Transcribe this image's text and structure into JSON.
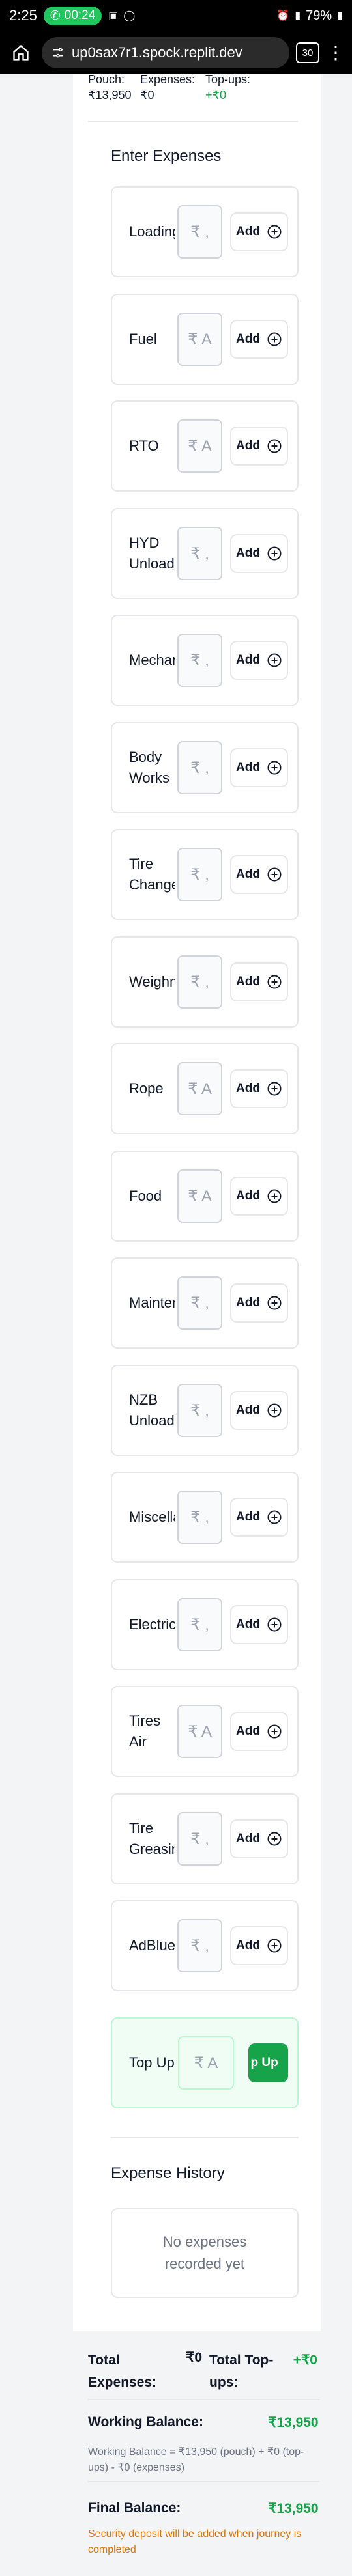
{
  "status_bar": {
    "time": "2:25",
    "call_time": "00:24",
    "battery": "79%"
  },
  "browser": {
    "url": "up0sax7r1.spock.replit.dev",
    "tab_count": "30"
  },
  "summary_top": {
    "pouch_label": "Pouch:",
    "pouch_value": "₹13,950",
    "expenses_label": "Expenses:",
    "expenses_value": "₹0",
    "topups_label": "Top-ups:",
    "topups_value": "+₹0"
  },
  "enter_expenses_title": "Enter Expenses",
  "add_label": "Add",
  "expenses": [
    {
      "label": "Loading",
      "placeholder": "₹ ,"
    },
    {
      "label": "Fuel",
      "placeholder": "₹ A"
    },
    {
      "label": "RTO",
      "placeholder": "₹ A"
    },
    {
      "label": "HYD Unloadi",
      "placeholder": "₹ ,"
    },
    {
      "label": "Mechan",
      "placeholder": "₹ ,"
    },
    {
      "label": "Body Works",
      "placeholder": "₹ ,"
    },
    {
      "label": "Tire Change",
      "placeholder": "₹ ,"
    },
    {
      "label": "Weighm",
      "placeholder": "₹ ,"
    },
    {
      "label": "Rope",
      "placeholder": "₹ A"
    },
    {
      "label": "Food",
      "placeholder": "₹ A"
    },
    {
      "label": "Mainten",
      "placeholder": "₹ ,"
    },
    {
      "label": "NZB Unloadi",
      "placeholder": "₹ ,"
    },
    {
      "label": "Miscella",
      "placeholder": "₹ ,"
    },
    {
      "label": "Electrica",
      "placeholder": "₹ ,"
    },
    {
      "label": "Tires Air",
      "placeholder": "₹ A"
    },
    {
      "label": "Tire Greasin",
      "placeholder": "₹ ,"
    },
    {
      "label": "AdBlue",
      "placeholder": "₹ ,"
    }
  ],
  "topup": {
    "label": "Top Up",
    "placeholder": "₹ A",
    "button": "p Up"
  },
  "history_title": "Expense History",
  "history_empty": "No expenses recorded yet",
  "summary_bottom": {
    "total_expenses_label": "Total Expenses:",
    "total_expenses_value": "₹0",
    "total_topups_label": "Total Top-ups:",
    "total_topups_value": "+₹0",
    "working_balance_label": "Working Balance:",
    "working_balance_value": "₹13,950",
    "working_balance_note": "Working Balance = ₹13,950 (pouch) + ₹0 (top-ups) - ₹0 (expenses)",
    "final_balance_label": "Final Balance:",
    "final_balance_value": "₹13,950",
    "security_note": "Security deposit will be added when journey is completed"
  }
}
